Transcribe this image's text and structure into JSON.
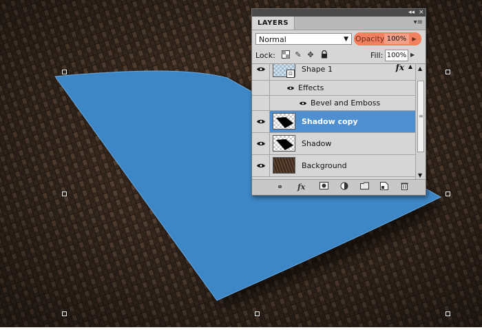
{
  "panel": {
    "title": "LAYERS",
    "collapse_glyph": "◂◂",
    "close_glyph": "×",
    "menu_glyph": "▾≡",
    "blend_mode": "Normal",
    "opacity_label": "Opacity:",
    "opacity_value": "100%",
    "lock_label": "Lock:",
    "fill_label": "Fill:",
    "fill_value": "100%"
  },
  "layers": [
    {
      "name": "Shape 1",
      "has_fx": true,
      "fx_label": "fx",
      "selected": false
    },
    {
      "name": "Shadow copy",
      "selected": true
    },
    {
      "name": "Shadow",
      "selected": false
    },
    {
      "name": "Background",
      "selected": false
    }
  ],
  "effects": {
    "header": "Effects",
    "items": [
      "Bevel and Emboss"
    ]
  },
  "icons": {
    "lock_transparent": "lock-transparent-icon",
    "lock_image": "lock-image-icon",
    "lock_position": "lock-position-icon",
    "lock_all": "lock-all-icon",
    "footer": [
      "link-icon",
      "fx-icon",
      "mask-icon",
      "adjustment-icon",
      "group-icon",
      "new-layer-icon",
      "trash-icon"
    ]
  },
  "colors": {
    "shape_fill": "#3d87c7",
    "selection": "#4f8fd0",
    "opacity_highlight": "#f08060"
  }
}
